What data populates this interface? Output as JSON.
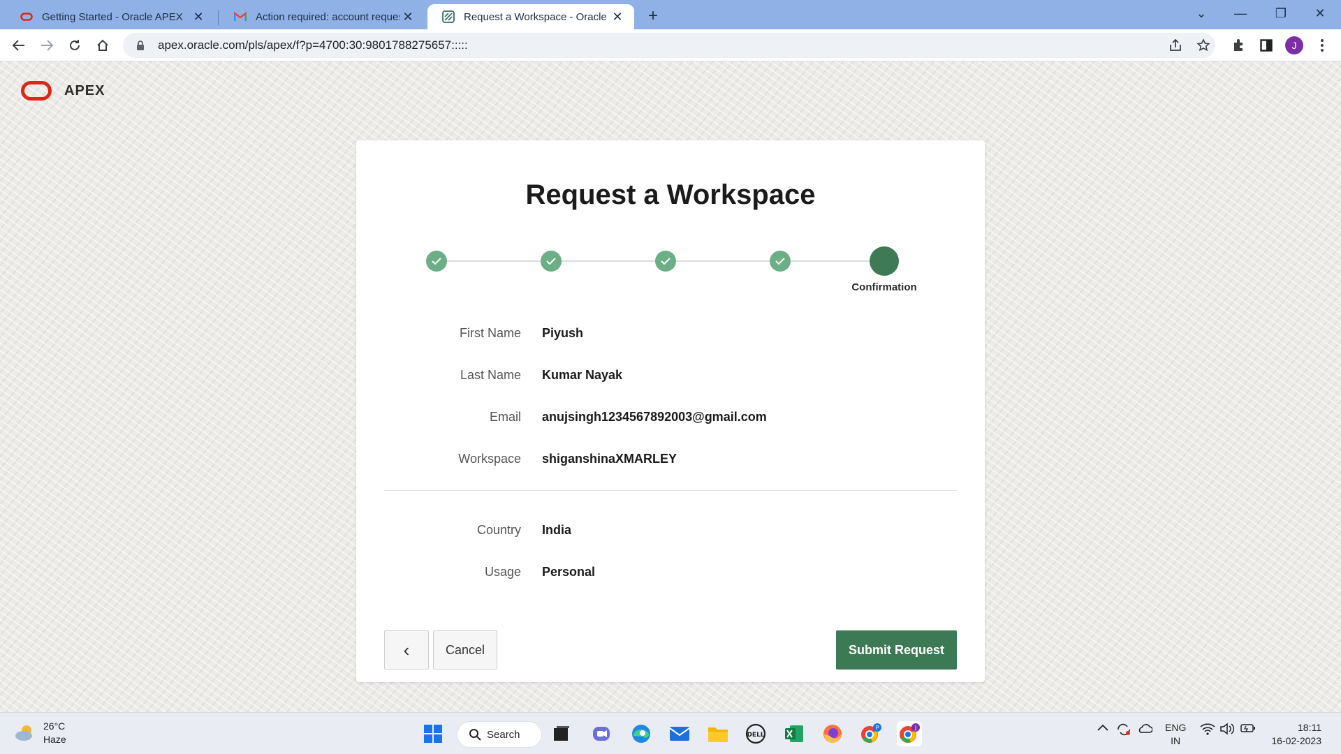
{
  "browser": {
    "tabs": [
      {
        "title": "Getting Started - Oracle APEX",
        "icon": "oracle-icon"
      },
      {
        "title": "Action required: account request",
        "icon": "gmail-icon"
      },
      {
        "title": "Request a Workspace - Oracle AP",
        "icon": "apex-icon"
      }
    ],
    "url": "apex.oracle.com/pls/apex/f?p=4700:30:9801788275657:::::",
    "profile_initial": "J"
  },
  "app": {
    "logo_text": "APEX"
  },
  "form": {
    "title": "Request a Workspace",
    "wizard": {
      "steps_completed": 4,
      "current_step_label": "Confirmation"
    },
    "fields": [
      {
        "label": "First Name",
        "value": "Piyush"
      },
      {
        "label": "Last Name",
        "value": "Kumar Nayak"
      },
      {
        "label": "Email",
        "value": "anujsingh1234567892003@gmail.com"
      },
      {
        "label": "Workspace",
        "value": "shiganshinaXMARLEY"
      }
    ],
    "extra_fields": [
      {
        "label": "Country",
        "value": "India"
      },
      {
        "label": "Usage",
        "value": "Personal"
      }
    ],
    "buttons": {
      "back_label": "‹",
      "cancel_label": "Cancel",
      "submit_label": "Submit Request"
    },
    "colors": {
      "primary": "#3b7a54",
      "step_done": "#6cae86"
    }
  },
  "taskbar": {
    "weather": {
      "temp": "26°C",
      "condition": "Haze"
    },
    "search_label": "Search",
    "lang_line1": "ENG",
    "lang_line2": "IN",
    "time": "18:11",
    "date": "16-02-2023"
  }
}
